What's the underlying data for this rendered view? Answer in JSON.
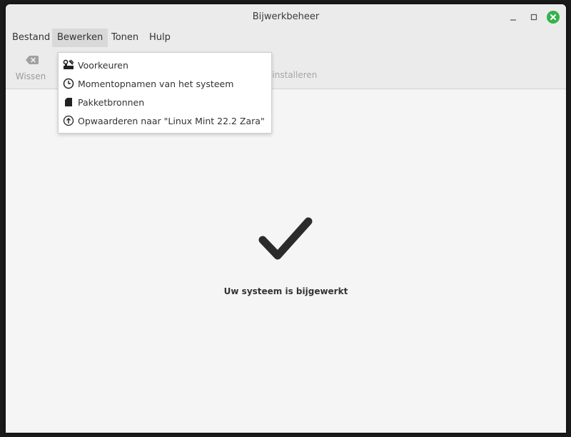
{
  "window": {
    "title": "Bijwerkbeheer"
  },
  "menubar": {
    "items": [
      {
        "label": "Bestand"
      },
      {
        "label": "Bewerken"
      },
      {
        "label": "Tonen"
      },
      {
        "label": "Hulp"
      }
    ]
  },
  "toolbar": {
    "clear_label": "Wissen",
    "install_label_partial": "n installeren"
  },
  "dropdown": {
    "items": [
      {
        "label": "Voorkeuren",
        "icon": "preferences-icon"
      },
      {
        "label": "Momentopnamen van het systeem",
        "icon": "clock-icon"
      },
      {
        "label": "Pakketbronnen",
        "icon": "package-icon"
      },
      {
        "label": "Opwaarderen naar \"Linux Mint 22.2 Zara\"",
        "icon": "upgrade-icon"
      }
    ]
  },
  "main": {
    "status": "Uw systeem is bijgewerkt",
    "icon": "checkmark-icon"
  },
  "colors": {
    "close_button": "#35b34a",
    "background": "#f5f5f5"
  }
}
